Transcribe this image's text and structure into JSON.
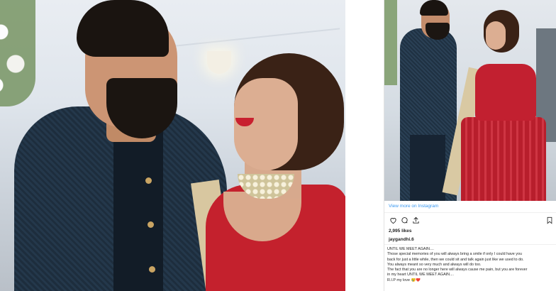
{
  "embed": {
    "view_more": "View more on Instagram",
    "likes": "2,995 likes",
    "username": "jaygandhi.6",
    "caption_lines": [
      "UNTIL WE MEET AGAIN....",
      "Those special memories of you will always bring a smile if only I could have you",
      "back for just a little while, then we could sit and talk again just like we used to do.",
      "You always meant so very much and always will do too.",
      "The fact that you are no longer here will always cause me pain, but you are forever",
      "in my heart UNTIL WE MEET AGAIN....",
      "R.I.P my love 😢❤️"
    ]
  },
  "icons": {
    "like": "heart-icon",
    "comment": "comment-icon",
    "share": "share-icon",
    "save": "bookmark-icon"
  }
}
